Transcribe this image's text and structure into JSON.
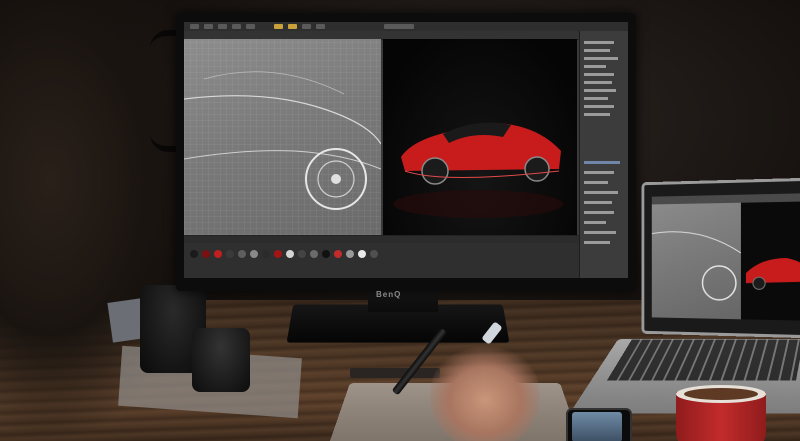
{
  "monitor": {
    "brand_label": "BenQ"
  },
  "scene": {
    "screen_material_colors": [
      "#1a1a1a",
      "#7a1010",
      "#c21f1f",
      "#3a3a3a",
      "#5e5e5e",
      "#8a8a8a",
      "#2b2b2b",
      "#a31515",
      "#d4d4d4",
      "#444444",
      "#6b6b6b",
      "#111111",
      "#c32b2b",
      "#999999",
      "#e8e8e8",
      "#505050"
    ]
  }
}
